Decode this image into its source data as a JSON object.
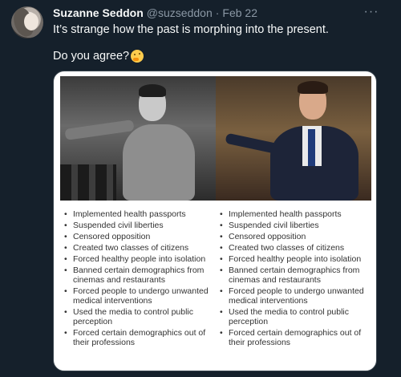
{
  "tweet": {
    "display_name": "Suzanne Seddon",
    "handle": "@suzseddon",
    "separator": "·",
    "date": "Feb 22",
    "more_icon": "···",
    "line1": "It’s strange how the past is morphing into the present.",
    "line2": "Do you agree?",
    "emoji": "thinking-face-icon"
  },
  "comparison": {
    "left_items": [
      "Implemented health passports",
      "Suspended civil liberties",
      "Censored opposition",
      "Created two classes of citizens",
      "Forced healthy people into isolation",
      "Banned certain demographics from cinemas and restaurants",
      "Forced people to undergo unwanted medical interventions",
      "Used the media to control public perception",
      "Forced certain demographics out of their professions"
    ],
    "right_items": [
      "Implemented health passports",
      "Suspended civil liberties",
      "Censored opposition",
      "Created two classes of citizens",
      "Forced healthy people into isolation",
      "Banned certain demographics from cinemas and restaurants",
      "Forced people to undergo unwanted medical interventions",
      "Used the media to control public perception",
      "Forced certain demographics out of their professions"
    ]
  },
  "colors": {
    "background": "#15202b",
    "text_primary": "#f7f9f9",
    "text_secondary": "#8b98a5"
  }
}
